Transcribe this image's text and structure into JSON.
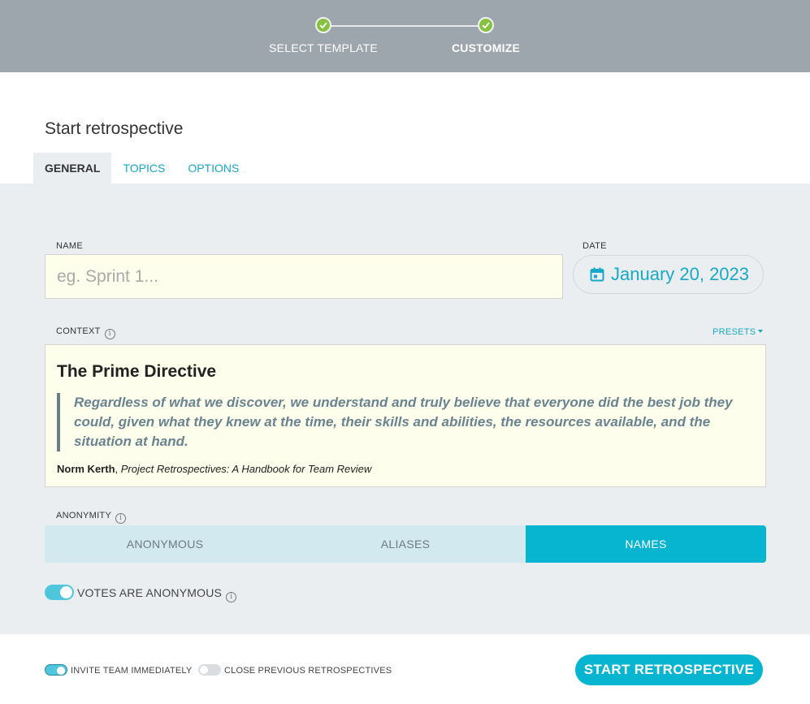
{
  "stepper": {
    "steps": [
      {
        "label": "SELECT TEMPLATE",
        "done": true
      },
      {
        "label": "CUSTOMIZE",
        "done": true,
        "current": true
      }
    ],
    "accent": "#86c13f"
  },
  "page": {
    "title": "Start retrospective"
  },
  "tabs": [
    {
      "label": "GENERAL",
      "active": true
    },
    {
      "label": "TOPICS",
      "active": false
    },
    {
      "label": "OPTIONS",
      "active": false
    }
  ],
  "form": {
    "name": {
      "label": "NAME",
      "placeholder": "eg. Sprint 1...",
      "value": ""
    },
    "date": {
      "label": "DATE",
      "value": "January 20, 2023",
      "icon": "calendar-icon"
    },
    "context": {
      "label": "CONTEXT",
      "presets_label": "PRESETS",
      "heading": "The Prime Directive",
      "quote": "Regardless of what we discover, we understand and truly believe that everyone did the best job they could, given what they knew at the time, their skills and abilities, the resources available, and the situation at hand.",
      "author": "Norm Kerth",
      "author_separator": ", ",
      "book": "Project Retrospectives: A Handbook for Team Review"
    },
    "anonymity": {
      "label": "ANONYMITY",
      "options": [
        "ANONYMOUS",
        "ALIASES",
        "NAMES"
      ],
      "selected": "NAMES"
    },
    "votes_anonymous": {
      "label": "VOTES ARE ANONYMOUS",
      "on": true
    }
  },
  "footer": {
    "invite_team": {
      "label": "INVITE TEAM IMMEDIATELY",
      "on": true
    },
    "close_previous": {
      "label": "CLOSE PREVIOUS RETROSPECTIVES",
      "on": false
    },
    "start_button": "START RETROSPECTIVE"
  },
  "colors": {
    "primary": "#08b5d0",
    "link": "#17a9c8",
    "header_bg": "#9ea6ad",
    "panel_bg": "#ebeef1",
    "input_bg": "#fefeec"
  }
}
